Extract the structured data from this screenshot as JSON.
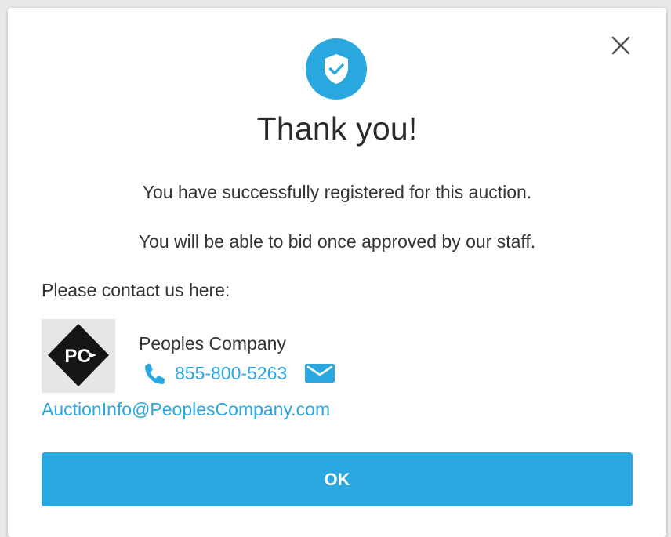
{
  "colors": {
    "accent": "#29a8e0",
    "text": "#333333",
    "title": "#2a2a2a",
    "icon_gray": "#555555",
    "logo_bg": "#e6e6e6"
  },
  "dialog": {
    "close_icon": "close-icon",
    "badge_icon": "shield-check-icon",
    "title": "Thank you!",
    "message_registered": "You have successfully registered for this auction.",
    "message_approval": "You will be able to bid once approved by our staff.",
    "contact_label": "Please contact us here:"
  },
  "contact": {
    "logo_icon": "peoples-company-logo",
    "logo_text": "PC",
    "company_name": "Peoples Company",
    "phone_icon": "phone-icon",
    "phone": "855-800-5263",
    "mail_icon": "mail-icon",
    "email": "AuctionInfo@PeoplesCompany.com"
  },
  "actions": {
    "ok_label": "OK"
  }
}
